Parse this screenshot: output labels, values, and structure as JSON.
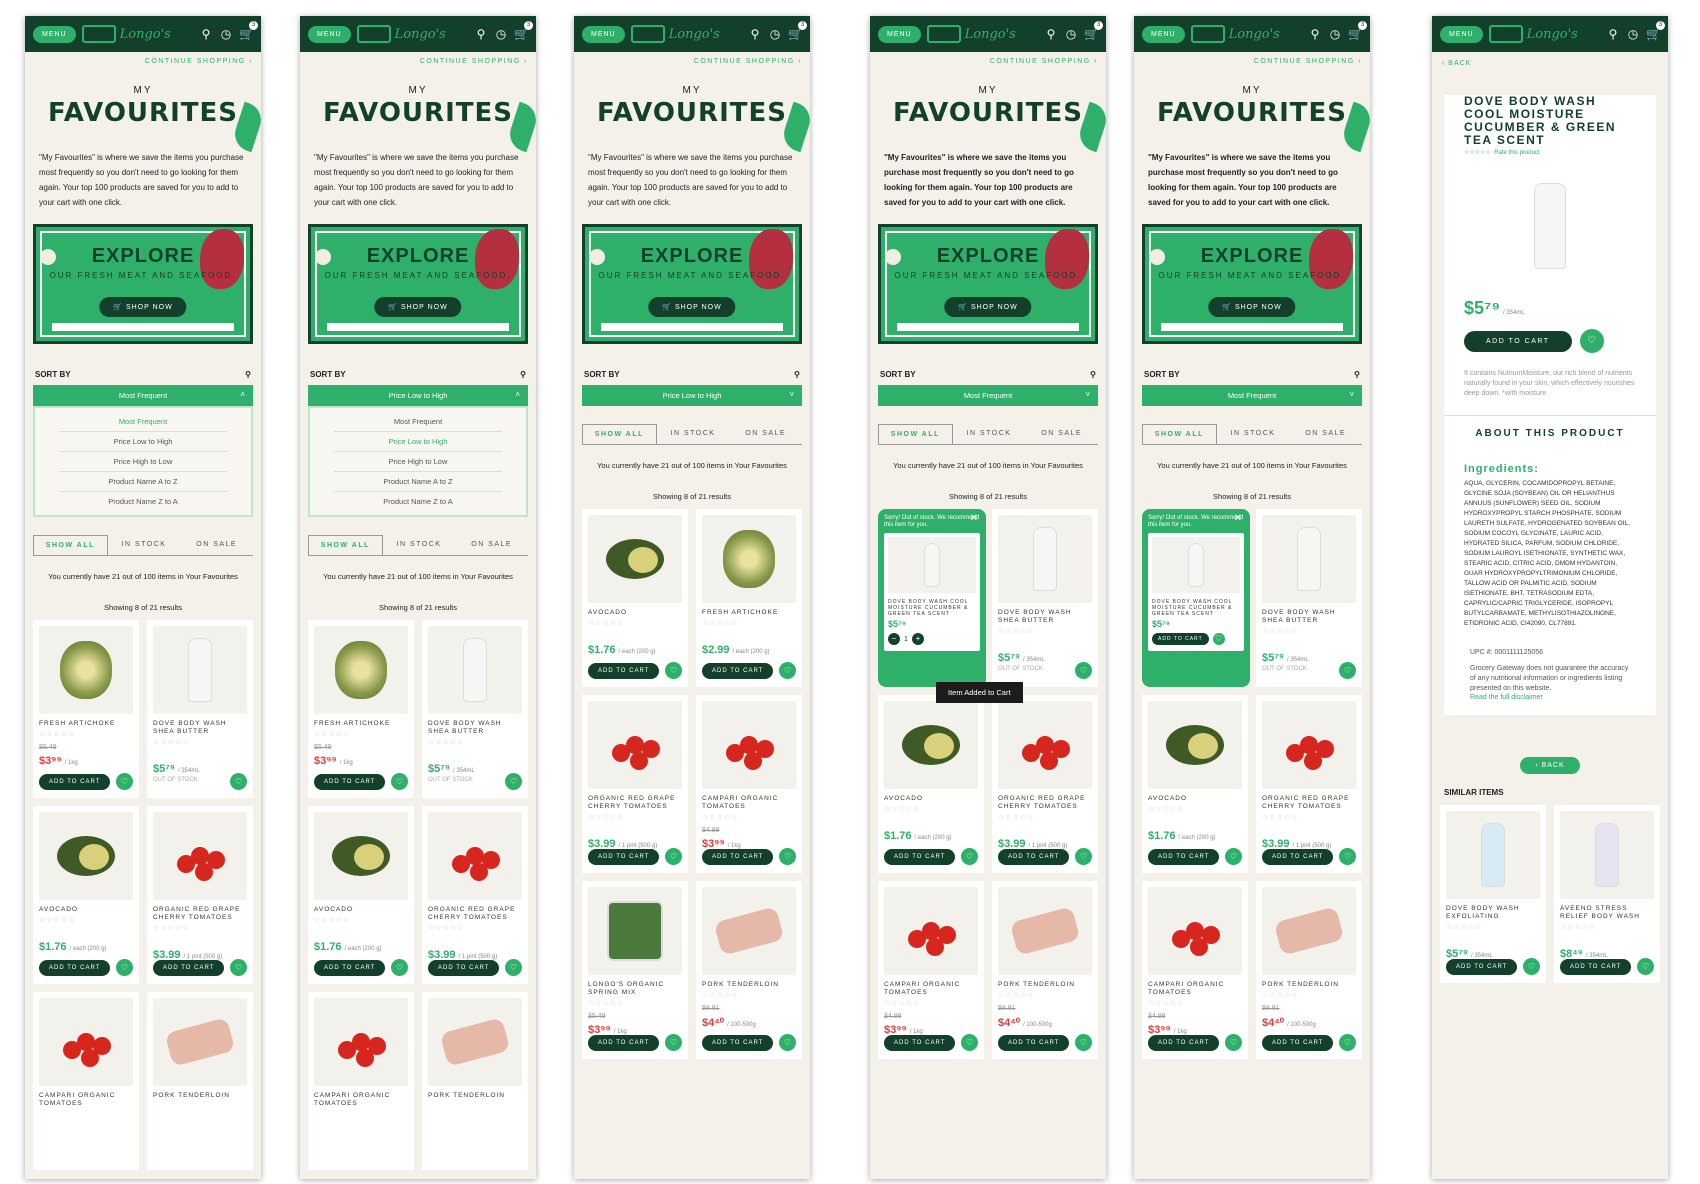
{
  "colors": {
    "brand_dark": "#12402b",
    "brand_green": "#2fb06a",
    "sale_red": "#e23b3b",
    "background": "#f4f1ea"
  },
  "header": {
    "menu": "MENU",
    "logo": "Longo's",
    "icons": [
      "search-icon",
      "clock-icon",
      "cart-icon"
    ],
    "cart_count": "3"
  },
  "continue_shopping": "CONTINUE SHOPPING",
  "my": "MY",
  "title": "FAVOURITES",
  "intro": "\"My Favourites\" is where we save the items you purchase most frequently so you don't need to go looking for them again. Your top 100 products are saved for you to add to your cart with one click.",
  "banner": {
    "title": "EXPLORE",
    "subtitle": "OUR FRESH MEAT AND SEAFOOD.",
    "button": "SHOP NOW"
  },
  "sort": {
    "label": "SORT BY",
    "options": [
      "Most Frequent",
      "Price Low to High",
      "Price High to Low",
      "Product Name A to Z",
      "Product Name Z to A"
    ],
    "screens": [
      "Most Frequent",
      "Price Low to High",
      "Price Low to High",
      "Most Frequent",
      "Most Frequent"
    ]
  },
  "tabs": [
    "SHOW ALL",
    "IN STOCK",
    "ON SALE"
  ],
  "counts": "You currently have 21 out of 100 items in Your Favourites",
  "showing": "Showing 8 of 21 results",
  "toast": "Item Added to Cart",
  "popup": {
    "title": "Sorry! Out of stock. We recommend this item for you.",
    "product": "DOVE BODY WASH COOL MOISTURE CUCUMBER & GREEN TEA SCENT",
    "price": "$5⁷⁹",
    "qty": "1"
  },
  "products": {
    "artichoke": {
      "name": "FRESH ARTICHOKE",
      "was": "$5.49",
      "price": "$3⁹⁹",
      "unit": "/ 1kg",
      "sale": true,
      "add": "ADD TO CART"
    },
    "dove_shea": {
      "name": "DOVE BODY WASH SHEA BUTTER",
      "was": "",
      "price": "$5⁷⁹",
      "unit": "/ 354mL",
      "oos": "OUT OF STOCK",
      "add": "ADD TO CART"
    },
    "avocado": {
      "name": "AVOCADO",
      "was": "",
      "price": "$1.76",
      "unit": "/ each (200 g)",
      "add": "ADD TO CART"
    },
    "grape_tomato": {
      "name": "ORGANIC RED GRAPE CHERRY TOMATOES",
      "was": "",
      "price": "$3.99",
      "unit": "/ 1 pint (500 g)",
      "add": "ADD TO CART"
    },
    "campari": {
      "name": "CAMPARI ORGANIC TOMATOES",
      "was": "$4.99",
      "price": "$3⁹⁹",
      "unit": "/ 1kg",
      "sale": true,
      "add": "ADD TO CART"
    },
    "pork": {
      "name": "PORK TENDERLOIN",
      "was": "$8.81",
      "price": "$4⁴⁰",
      "unit": "/ 100-500g",
      "sale": true,
      "add": "ADD TO CART"
    },
    "salad": {
      "name": "LONGO'S ORGANIC SPRING MIX",
      "was": "$5.49",
      "price": "$3⁹⁹",
      "unit": "/ 1kg",
      "sale": true,
      "add": "ADD TO CART"
    }
  },
  "detail": {
    "back": "BACK",
    "title": "DOVE BODY WASH COOL MOISTURE CUCUMBER & GREEN TEA SCENT",
    "rate": "Rate this product",
    "price": "$5⁷⁹",
    "unit": "/ 354mL",
    "add": "ADD TO CART",
    "desc": "It contains NutriumMoisture, our rich blend of nutrients naturally found in your skin, which effectively nourishes deep down. *with moisture",
    "about": "ABOUT THIS PRODUCT",
    "ing_heading": "Ingredients:",
    "ingredients": "AQUA, GLYCERIN, COCAMIDOPROPYL BETAINE, GLYCINE SOJA (SOYBEAN) OIL OR HELIANTHUS ANNUUS (SUNFLOWER) SEED OIL, SODIUM HYDROXYPROPYL STARCH PHOSPHATE, SODIUM LAURETH SULFATE, HYDROGENATED SOYBEAN OIL, SODIUM COCOYL GLYCINATE, LAURIC ACID, HYDRATED SILICA, PARFUM, SODIUM CHLORIDE, SODIUM LAUROYL ISETHIONATE, SYNTHETIC WAX, STEARIC ACID, CITRIC ACID, DMDM HYDANTOIN, GUAR HYDROXYPROPYLTRIMONIUM CHLORIDE, TALLOW ACID OR PALMITIC ACID, SODIUM ISETHIONATE, BHT, TETRASODIUM EDTA, CAPRYLIC/CAPRIC TRIGLYCERIDE, ISOPROPYL BUTYLCARBAMATE, METHYLISOTHIAZOLINONE, ETIDRONIC ACID, CI42090, CL77891.",
    "upc": "UPC #: 0001111125056",
    "disclaimer": "Grocery Gateway does not guarantee the accuracy of any nutritional information or ingredients listing presented on this website.",
    "read": "Read the full disclaimer",
    "back2": "BACK",
    "similar": "SIMILAR ITEMS",
    "sim": [
      {
        "name": "DOVE BODY WASH EXFOLIATING",
        "price": "$5⁷⁹",
        "unit": "/ 354mL",
        "add": "ADD TO CART"
      },
      {
        "name": "AVEENO STRESS RELIEF BODY WASH",
        "price": "$8⁴⁹",
        "unit": "/ 354mL",
        "add": "ADD TO CART"
      }
    ]
  }
}
